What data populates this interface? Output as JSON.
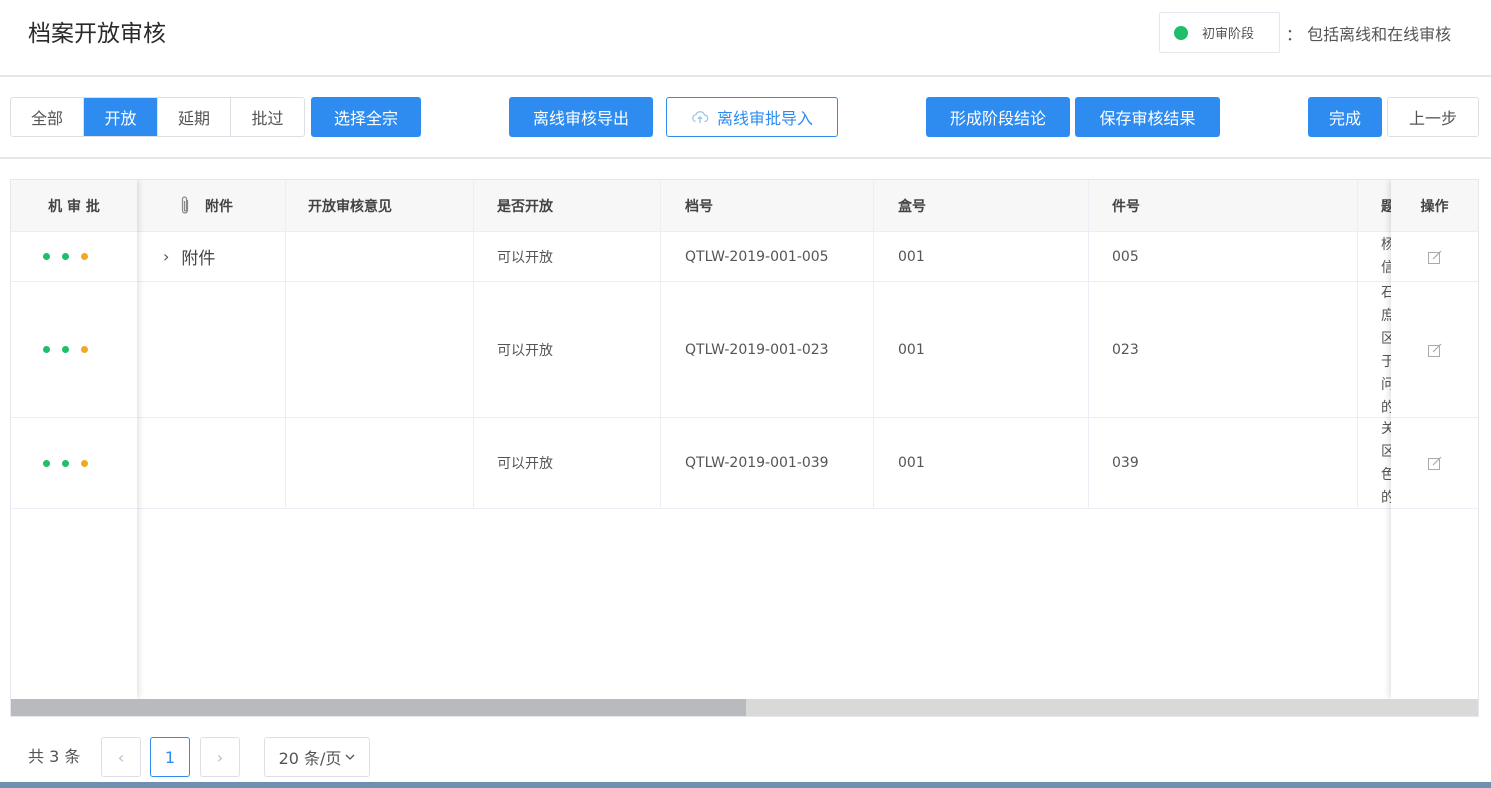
{
  "header": {
    "title": "档案开放审核",
    "stage_label": "初审阶段",
    "stage_color": "#1fbe6a",
    "stage_desc": "： 包括离线和在线审核"
  },
  "toolbar": {
    "filters": [
      "全部",
      "开放",
      "延期",
      "批过"
    ],
    "active_filter": "开放",
    "select_all": "选择全宗",
    "export_offline": "离线审核导出",
    "import_offline": "离线审批导入",
    "stage_conclusion": "形成阶段结论",
    "save_results": "保存审核结果",
    "finish": "完成",
    "prev_step": "上一步"
  },
  "table": {
    "columns": {
      "machine": "机 审 批",
      "attachment": "附件",
      "opinion": "开放审核意见",
      "is_open": "是否开放",
      "file_no": "档号",
      "box_no": "盒号",
      "item_no": "件号",
      "title": "题",
      "actions": "操作"
    },
    "rows": [
      {
        "dots": [
          "#1fbe6a",
          "#1fbe6a",
          "#f5a623"
        ],
        "attachment": "附件",
        "opinion": "",
        "is_open": "可以开放",
        "file_no": "QTLW-2019-001-005",
        "box_no": "001",
        "item_no": "005",
        "title_chars": [
          "杨",
          "信"
        ]
      },
      {
        "dots": [
          "#1fbe6a",
          "#1fbe6a",
          "#f5a623"
        ],
        "attachment": "",
        "opinion": "",
        "is_open": "可以开放",
        "file_no": "QTLW-2019-001-023",
        "box_no": "001",
        "item_no": "023",
        "title_chars": [
          "石",
          "庶",
          "区",
          "于",
          "问",
          "的"
        ]
      },
      {
        "dots": [
          "#1fbe6a",
          "#1fbe6a",
          "#f5a623"
        ],
        "attachment": "",
        "opinion": "",
        "is_open": "可以开放",
        "file_no": "QTLW-2019-001-039",
        "box_no": "001",
        "item_no": "039",
        "title_chars": [
          "关",
          "区",
          "色",
          "的"
        ]
      }
    ]
  },
  "pagination": {
    "total": "共 3 条",
    "current_page": "1",
    "page_size": "20 条/页"
  },
  "colors": {
    "primary": "#2e8cf0",
    "green": "#1fbe6a",
    "orange": "#f5a623"
  }
}
